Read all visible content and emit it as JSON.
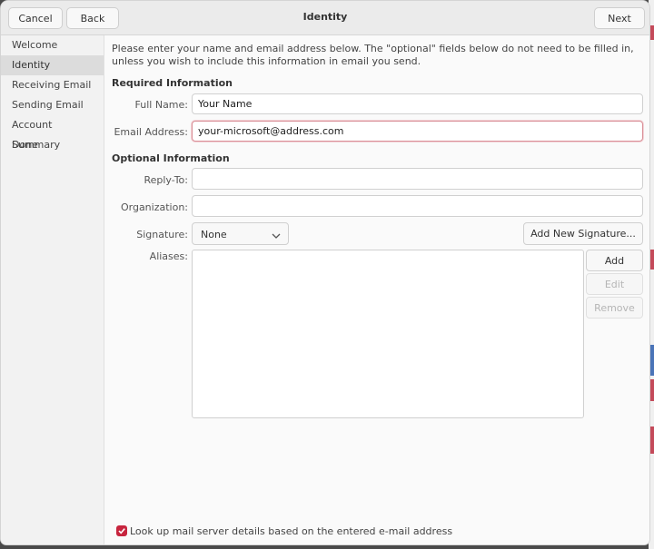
{
  "header": {
    "cancel_label": "Cancel",
    "back_label": "Back",
    "title": "Identity",
    "next_label": "Next"
  },
  "sidebar": {
    "items": [
      {
        "label": "Welcome",
        "active": false
      },
      {
        "label": "Identity",
        "active": true
      },
      {
        "label": "Receiving Email",
        "active": false
      },
      {
        "label": "Sending Email",
        "active": false
      },
      {
        "label": "Account Summary",
        "active": false
      },
      {
        "label": "Done",
        "active": false
      }
    ]
  },
  "main": {
    "intro": "Please enter your name and email address below. The \"optional\" fields below do not need to be filled in, unless you wish to include this information in email you send.",
    "required_heading": "Required Information",
    "optional_heading": "Optional Information",
    "full_name": {
      "label": "Full Name:",
      "value": "Your Name"
    },
    "email": {
      "label": "Email Address:",
      "value": "your-microsoft@address.com"
    },
    "reply_to": {
      "label": "Reply-To:",
      "value": ""
    },
    "organization": {
      "label": "Organization:",
      "value": ""
    },
    "signature": {
      "label": "Signature:",
      "selected": "None",
      "add_button": "Add New Signature..."
    },
    "aliases": {
      "label": "Aliases:",
      "add": "Add",
      "edit": "Edit",
      "remove": "Remove"
    },
    "lookup": {
      "label": "Look up mail server details based on the entered e-mail address",
      "checked": true
    }
  },
  "colors": {
    "accent": "#c7253e",
    "focus_border": "#d98f97"
  }
}
